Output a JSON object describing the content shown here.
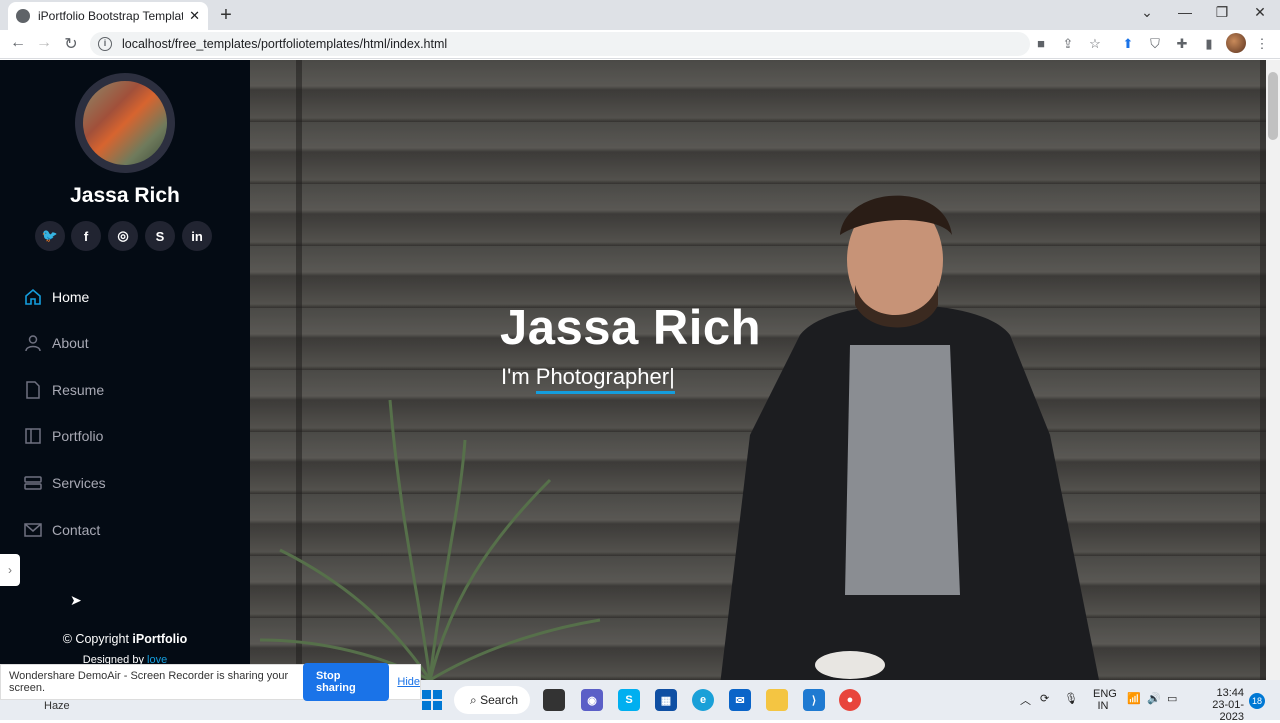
{
  "browser": {
    "tab_title": "iPortfolio Bootstrap Template - In",
    "url": "localhost/free_templates/portfoliotemplates/html/index.html"
  },
  "sidebar": {
    "name": "Jassa Rich",
    "social": [
      {
        "icon": "twitter-icon",
        "glyph": "🐦"
      },
      {
        "icon": "facebook-icon",
        "glyph": "f"
      },
      {
        "icon": "instagram-icon",
        "glyph": "◎"
      },
      {
        "icon": "skype-icon",
        "glyph": "S"
      },
      {
        "icon": "linkedin-icon",
        "glyph": "in"
      }
    ],
    "nav": [
      {
        "label": "Home",
        "icon": "house-icon",
        "active": true
      },
      {
        "label": "About",
        "icon": "person-icon",
        "active": false
      },
      {
        "label": "Resume",
        "icon": "file-icon",
        "active": false
      },
      {
        "label": "Portfolio",
        "icon": "book-icon",
        "active": false
      },
      {
        "label": "Services",
        "icon": "server-icon",
        "active": false
      },
      {
        "label": "Contact",
        "icon": "envelope-icon",
        "active": false
      }
    ],
    "copyright_prefix": "© Copyright ",
    "copyright_brand": "iPortfolio",
    "designed_prefix": "Designed by ",
    "designed_link": "love"
  },
  "hero": {
    "name": "Jassa Rich",
    "prefix": "I'm ",
    "typed": "Photographer|"
  },
  "share_banner": {
    "message": "Wondershare DemoAir - Screen Recorder is sharing your screen.",
    "stop": "Stop sharing",
    "hide": "Hide"
  },
  "taskbar": {
    "weather": "Haze",
    "search": "Search",
    "lang_top": "ENG",
    "lang_bottom": "IN",
    "time": "13:44",
    "date": "23-01-2023",
    "notifications": "18"
  },
  "colors": {
    "accent": "#149ddd",
    "sidebar_bg": "#040b14"
  }
}
